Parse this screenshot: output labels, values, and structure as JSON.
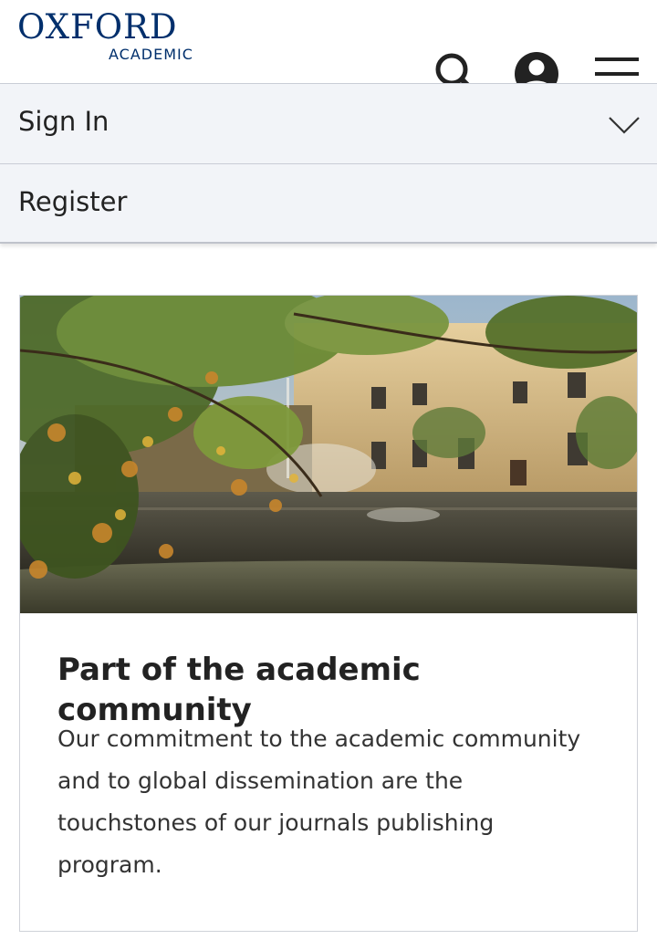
{
  "header": {
    "logo_main": "OXFORD",
    "logo_sub": "ACADEMIC",
    "icons": [
      "search-icon",
      "user-account-icon",
      "hamburger-menu-icon"
    ]
  },
  "account_menu": {
    "items": [
      {
        "label": "Sign In",
        "icon": "chevron-down-icon"
      },
      {
        "label": "Register"
      }
    ]
  },
  "feature_card": {
    "image": "courtyard-fountain-photo",
    "title": "Part of the academic community",
    "text": "Our commitment to the academic community and to global dissemination are the touchstones of our journals publishing program."
  },
  "colors": {
    "brand_navy": "#002f6c",
    "menu_bg": "#f2f4f8",
    "text_dark": "#222222"
  }
}
